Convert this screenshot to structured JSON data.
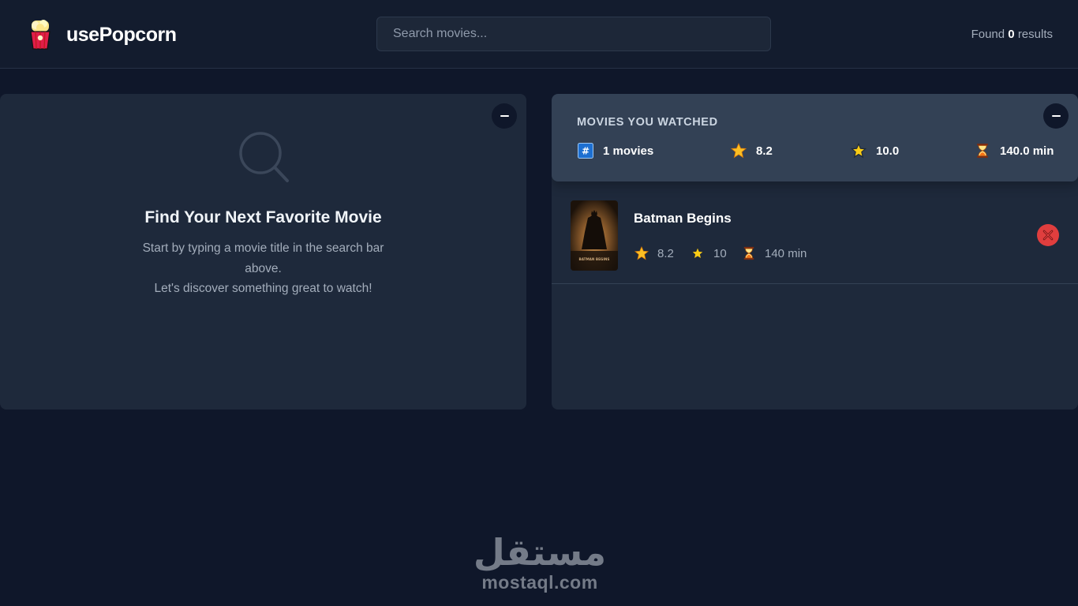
{
  "app": {
    "name": "usePopcorn",
    "logo_icon": "popcorn-icon"
  },
  "search": {
    "placeholder": "Search movies...",
    "value": ""
  },
  "results": {
    "prefix": "Found",
    "count": "0",
    "suffix": "results"
  },
  "left_panel": {
    "icon": "search-icon",
    "title": "Find Your Next Favorite Movie",
    "subtitle_line1": "Start by typing a movie title in the search bar above.",
    "subtitle_line2": "Let's discover something great to watch!"
  },
  "summary": {
    "title": "MOVIES YOU WATCHED",
    "movies_count": "1 movies",
    "avg_imdb_rating": "8.2",
    "avg_user_rating": "10.0",
    "avg_runtime": "140.0 min"
  },
  "watched": [
    {
      "title": "Batman Begins",
      "imdb_rating": "8.2",
      "user_rating": "10",
      "runtime": "140 min",
      "poster_text": "BATMAN BEGINS"
    }
  ],
  "watermark": {
    "arabic": "مستقل",
    "latin": "mostaql.com"
  },
  "colors": {
    "background": "#0f172a",
    "panel": "#1e293b",
    "summary": "#334155",
    "delete": "#e03e3e",
    "star": "#fbbf24"
  }
}
